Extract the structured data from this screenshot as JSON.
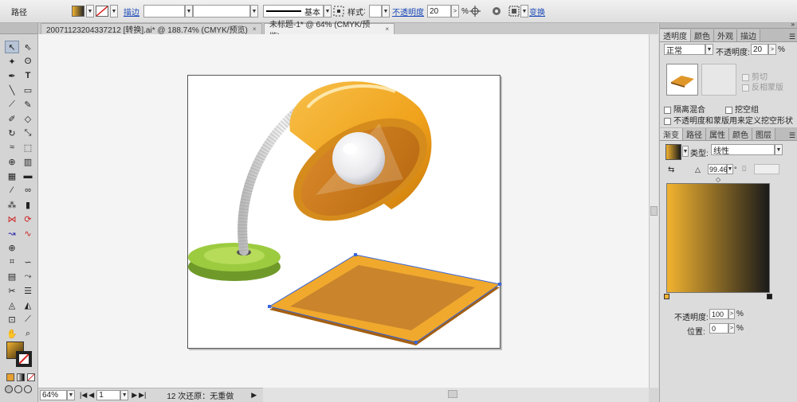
{
  "control_bar": {
    "object_type": "路径",
    "stroke_label": "描边",
    "stroke_weight": "",
    "stroke_profile": "",
    "brush_label": "基本",
    "style_label": "样式",
    "opacity_label": "不透明度",
    "opacity_value": "20",
    "opacity_unit": "%",
    "transform_label": "变换"
  },
  "tabs": [
    {
      "label": "20071123204337212 [转换].ai* @ 188.74% (CMYK/预览)",
      "close": "×"
    },
    {
      "label": "未标题-1* @ 64% (CMYK/预览)",
      "close": "×"
    }
  ],
  "status": {
    "zoom": "64%",
    "artboard": "1",
    "history": "12 次还原：无重做"
  },
  "transparency_panel": {
    "tabs": [
      "透明度",
      "颜色",
      "外观",
      "描边"
    ],
    "blend_mode": "正常",
    "opacity_label": "不透明度:",
    "opacity_value": "20",
    "opacity_unit": "%",
    "clip_label": "剪切",
    "invert_label": "反相蒙版",
    "isolate_label": "隔离混合",
    "knockout_label": "挖空组",
    "opacity_mask_label": "不透明度和蒙版用来定义挖空形状"
  },
  "gradient_panel": {
    "tabs": [
      "渐变",
      "路径",
      "属性",
      "颜色",
      "图层"
    ],
    "type_label": "类型:",
    "type_value": "线性",
    "angle_value": "99.46",
    "angle_unit": "°",
    "opacity_label": "不透明度:",
    "opacity_value": "100",
    "opacity_unit": "%",
    "location_label": "位置:",
    "location_value": "0",
    "location_unit": "%",
    "stop_left_color": "#F2B330",
    "stop_right_color": "#1A1A1A"
  },
  "colors": {
    "lamp_shade": "#F2A51F",
    "lamp_base": "#8DC43E",
    "mat": "#E09A2A",
    "selection": "#3A66D9"
  }
}
